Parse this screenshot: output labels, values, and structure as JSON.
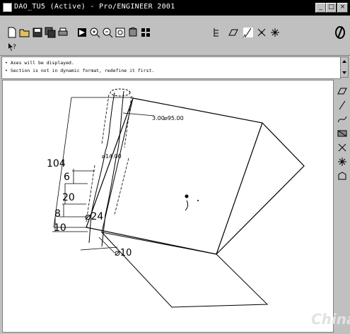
{
  "window": {
    "title": "DAO_TU5 (Active) - Pro/ENGINEER 2001",
    "controls": [
      "_",
      "□",
      "×"
    ]
  },
  "messages": [
    "Axes will be displayed.",
    "Section is not in dynamic format, redefine it first."
  ],
  "drawing": {
    "dim_total": "104",
    "dim_a": "6",
    "dim_b": "20",
    "dim_c": "8",
    "dim_d": "10",
    "dia_24": "⌀24",
    "dia_10": "⌀10",
    "dia_small": "⌀14.00",
    "dia_top": "⌀95.00",
    "dia_top_prefix": "3.00"
  },
  "watermark": "China"
}
